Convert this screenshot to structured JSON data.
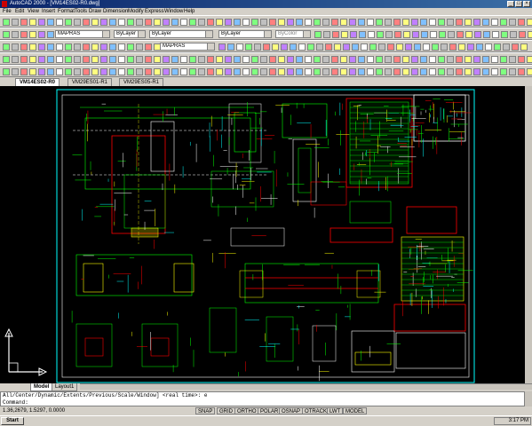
{
  "window": {
    "title": "AutoCAD 2000 - [VM14ES02-R0.dwg]",
    "min": "_",
    "max": "□",
    "close": "×"
  },
  "menu": [
    "File",
    "Edit",
    "View",
    "Insert",
    "Format",
    "Tools",
    "Draw",
    "Dimension",
    "Modify",
    "Express",
    "Window",
    "Help"
  ],
  "toolbar": {
    "layer": "MAPRAS",
    "color": "ByLayer",
    "linetype": "ByLayer",
    "lineweight": "ByLayer",
    "plotstyle": "ByColor",
    "layer2": "MAPRAS"
  },
  "tabs": [
    "VM14ES02-R0",
    "VM29ES01-R1",
    "VM29ES05-R1"
  ],
  "layout_tabs": [
    "Model",
    "Layout1"
  ],
  "command": {
    "history": "All/Center/Dynamic/Extents/Previous/Scale/Window] <real time>: e",
    "prompt": "Command:"
  },
  "status": {
    "coords": "1.36,2679, 1.5297, 0.0000",
    "buttons": [
      "SNAP",
      "GRID",
      "ORTHO",
      "POLAR",
      "OSNAP",
      "OTRACK",
      "LWT",
      "MODEL"
    ]
  },
  "taskbar": {
    "start": "Start",
    "clock": "3:17 PM"
  },
  "colors": {
    "drawing_bg": "#000000",
    "line_green": "#00ff00",
    "line_red": "#ff0000",
    "line_yellow": "#ffff00",
    "line_cyan": "#00ffff",
    "line_white": "#ffffff"
  }
}
